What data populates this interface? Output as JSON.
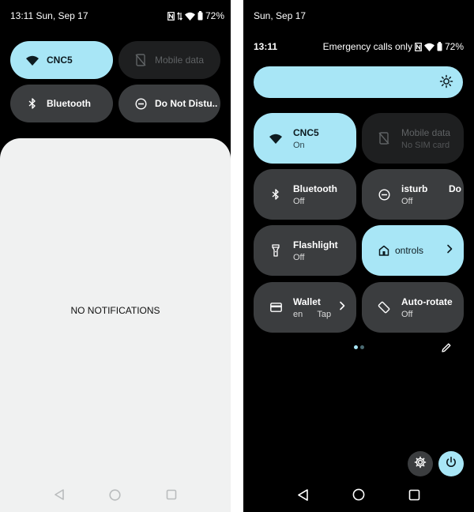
{
  "left": {
    "status": {
      "time_date": "13:11 Sun, Sep 17",
      "battery": "72%"
    },
    "tiles": [
      {
        "label": "CNC5",
        "state": "on"
      },
      {
        "label": "Mobile data",
        "state": "unavailable"
      },
      {
        "label": "Bluetooth",
        "state": "off"
      },
      {
        "label": "Do Not Distu..",
        "state": "off"
      }
    ],
    "notifications": {
      "empty_text": "NO NOTIFICATIONS"
    }
  },
  "right": {
    "header": {
      "date": "Sun, Sep 17",
      "time": "13:11",
      "carrier": "Emergency calls only",
      "battery": "72%"
    },
    "tiles": [
      {
        "label": "CNC5",
        "sub": "On",
        "state": "on"
      },
      {
        "label": "Mobile data",
        "sub": "No SIM card",
        "state": "unavailable"
      },
      {
        "label": "Bluetooth",
        "sub": "Off",
        "state": "off"
      },
      {
        "label": "isturb        Do",
        "sub": "Off",
        "state": "off"
      },
      {
        "label": "Flashlight",
        "sub": "Off",
        "state": "off"
      },
      {
        "label": "ontrols",
        "sub": "",
        "state": "on"
      },
      {
        "label": "Wallet",
        "sub": "en      Tap",
        "state": "off"
      },
      {
        "label": "Auto-rotate",
        "sub": "Off",
        "state": "off"
      }
    ]
  },
  "colors": {
    "accent": "#a8e6f6",
    "tile_off": "#3b3d3f",
    "tile_unavailable": "#1e1f20",
    "background": "#000000",
    "shade": "#f0f1f1"
  },
  "icons": [
    "nfc-icon",
    "data-arrows-icon",
    "wifi-icon",
    "battery-icon",
    "mobile-data-off-icon",
    "bluetooth-icon",
    "do-not-disturb-icon",
    "brightness-icon",
    "flashlight-icon",
    "home-icon",
    "wallet-icon",
    "auto-rotate-icon",
    "chevron-right-icon",
    "edit-icon",
    "settings-icon",
    "power-icon",
    "back-icon",
    "home-nav-icon",
    "recents-icon"
  ]
}
